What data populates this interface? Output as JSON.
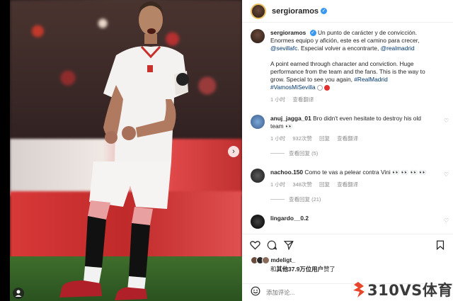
{
  "post": {
    "username": "sergioramos",
    "caption_es": "Un punto de carácter y de convicción. Enormes equipo y afición, este es el camino para crecer,",
    "caption_link1": "@sevillafc",
    "caption_es2": ". Especial volver a encontrarte,",
    "caption_link2": "@realmadrid",
    "caption_en": "A point earned through character and conviction. Huge performance from the team and the fans. This is the way to grow. Special to see you again,",
    "caption_tag1": "#RealMadrid",
    "caption_tag2": "#VamosMiSevilla",
    "caption_time": "1 小时",
    "see_translation": "查看翻译"
  },
  "comments": [
    {
      "username": "anuj_jagga_01",
      "text": "Bro didn't even hesitate to destroy his old team 👀",
      "time": "1 小时",
      "likes": "932次赞",
      "reply": "回复",
      "translate": "查看翻译",
      "view_replies": "查看回复 (5)"
    },
    {
      "username": "nachoo.150",
      "text": "Como te vas a pelear contra Vini 👀 👀 👀 👀",
      "time": "1 小时",
      "likes": "348次赞",
      "reply": "回复",
      "translate": "查看翻译",
      "view_replies": "查看回复 (21)"
    },
    {
      "username": "lingardo__0.2",
      "text": ""
    }
  ],
  "likes": {
    "user": "mdeligt_",
    "prefix": "和",
    "others": "其他37.9万位用户",
    "suffix": "赞了"
  },
  "add_comment_placeholder": "添加评论...",
  "watermark": "310VS体育",
  "colors": {
    "link": "#00376b",
    "verified": "#3897f0",
    "watermark_icon": "#e8462a"
  }
}
